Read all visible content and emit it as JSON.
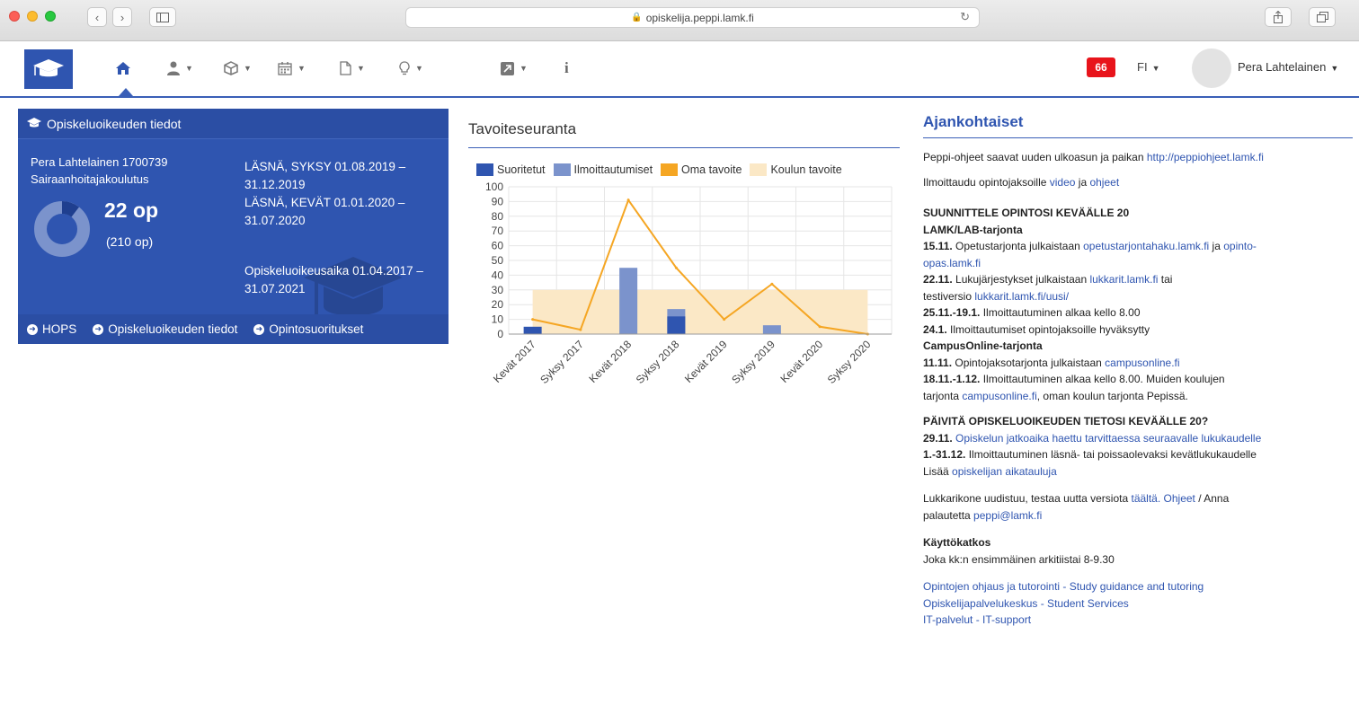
{
  "browser": {
    "url": "opiskelija.peppi.lamk.fi"
  },
  "navbar": {
    "notifications": "66",
    "lang": "FI",
    "user": "Pera Lahtelainen"
  },
  "panel": {
    "title": "Opiskeluoikeuden tiedot",
    "name_line": "Pera Lahtelainen 1700739",
    "program": "Sairaanhoitajakoulutus",
    "credits": "22 op",
    "credits_total": "(210 op)",
    "credits_progress": 0.105,
    "status1": "LÄSNÄ, SYKSY 01.08.2019 – 31.12.2019",
    "status2": "LÄSNÄ, KEVÄT 01.01.2020 – 31.07.2020",
    "rights_period": "Opiskeluoikeusaika 01.04.2017 – 31.07.2021",
    "links": [
      "HOPS",
      "Opiskeluoikeuden tiedot",
      "Opintosuoritukset"
    ]
  },
  "chart_title": "Tavoiteseuranta",
  "chart_data": {
    "type": "bar",
    "categories": [
      "Kevät 2017",
      "Syksy 2017",
      "Kevät 2018",
      "Syksy 2018",
      "Kevät 2019",
      "Syksy 2019",
      "Kevät 2020",
      "Syksy 2020"
    ],
    "ylim": [
      0,
      100
    ],
    "yticks": [
      0,
      10,
      20,
      30,
      40,
      50,
      60,
      70,
      80,
      90,
      100
    ],
    "series": [
      {
        "name": "Suoritetut",
        "kind": "bar",
        "color": "#2f55b0",
        "values": [
          5,
          0,
          0,
          12,
          0,
          0,
          0,
          0
        ]
      },
      {
        "name": "Ilmoittautumiset",
        "kind": "bar",
        "color": "#7b93cc",
        "values": [
          0,
          0,
          45,
          17,
          0,
          6,
          0,
          0
        ]
      },
      {
        "name": "Oma tavoite",
        "kind": "line",
        "color": "#f5a623",
        "values": [
          10,
          3,
          91,
          45,
          10,
          34,
          5,
          0
        ]
      },
      {
        "name": "Koulun tavoite",
        "kind": "band",
        "color": "#fbe8c6",
        "values": [
          30,
          30,
          30,
          30,
          30,
          30,
          30,
          30
        ]
      }
    ]
  },
  "news": {
    "title": "Ajankohtaiset",
    "p1_text": "Peppi-ohjeet saavat uuden ulkoasun ja paikan ",
    "p1_link": "http://peppiohjeet.lamk.fi",
    "p2_text": "Ilmoittaudu opintojaksoille ",
    "p2_link1": "video",
    "p2_mid": " ja ",
    "p2_link2": "ohjeet",
    "plan_title": "SUUNNITTELE OPINTOSI KEVÄÄLLE 20",
    "lab_title": "LAMK/LAB-tarjonta",
    "l1_date": "15.11.",
    "l1_text": " Opetustarjonta julkaistaan ",
    "l1_link1": "opetustarjontahaku.lamk.fi",
    "l1_mid": " ja ",
    "l1_link2a": "opinto-",
    "l1_link2b": "opas.lamk.fi",
    "l2_date": "22.11.",
    "l2_text": " Lukujärjestykset julkaistaan ",
    "l2_link1": "lukkarit.lamk.fi",
    "l2_mid": " tai",
    "l2_text2": "testiversio ",
    "l2_link2": "lukkarit.lamk.fi/uusi/",
    "l3_date": "25.11.-19.1.",
    "l3_text": " Ilmoittautuminen alkaa kello 8.00",
    "l4_date": "24.1.",
    "l4_text": " Ilmoittautumiset opintojaksoille hyväksytty",
    "campus_title": "CampusOnline-tarjonta",
    "c1_date": "11.11.",
    "c1_text": " Opintojaksotarjonta julkaistaan ",
    "c1_link": "campusonline.fi",
    "c2_date": "18.11.-1.12.",
    "c2_text": " Ilmoittautuminen alkaa kello 8.00. Muiden koulujen",
    "c2_text2": "tarjonta ",
    "c2_link": "campusonline.fi",
    "c2_text3": ", oman koulun tarjonta Pepissä.",
    "update_title": "PÄIVITÄ OPISKELUOIKEUDEN TIETOSI KEVÄÄLLE 20?",
    "u1_date": "29.11.",
    "u1_link": "Opiskelun jatkoaika haettu tarvittaessa seuraavalle lukukaudelle",
    "u2_date": "1.-31.12.",
    "u2_text": " Ilmoittautuminen läsnä- tai poissaolevaksi kevätlukukaudelle",
    "u3_text": "Lisää ",
    "u3_link": "opiskelijan aikatauluja",
    "lk_text": "Lukkarikone uudistuu, testaa uutta versiota ",
    "lk_link1": "täältä.",
    "lk_link2": "Ohjeet",
    "lk_text2": " / Anna",
    "lk_text3": "palautetta ",
    "lk_link3": "peppi@lamk.fi",
    "break_title": "Käyttökatkos",
    "break_text": "Joka kk:n ensimmäinen arkitiistai 8-9.30",
    "link_a": "Opintojen ohjaus ja tutorointi - Study guidance and tutoring",
    "link_b": "Opiskelijapalvelukeskus - Student Services",
    "link_c": "IT-palvelut - IT-support"
  }
}
